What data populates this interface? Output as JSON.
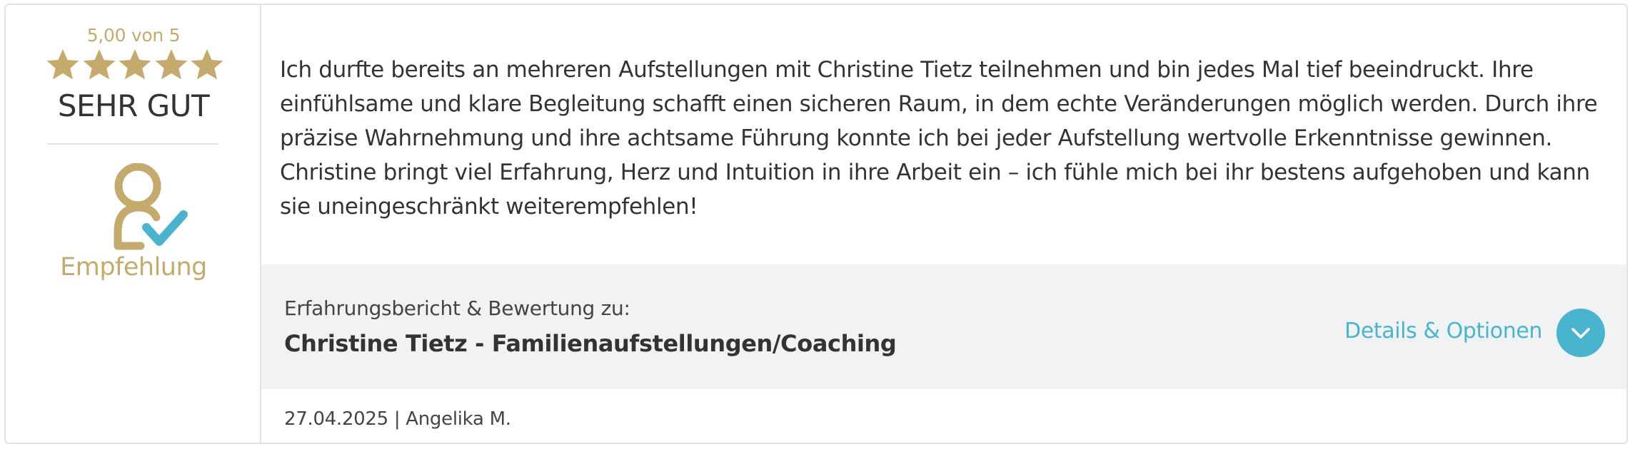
{
  "rating": {
    "score_text": "5,00 von 5",
    "value": 5,
    "max": 5,
    "grade": "SEHR GUT",
    "star_color": "#c4ab6d"
  },
  "recommendation": {
    "icon": "user-check-icon",
    "label": "Empfehlung"
  },
  "review": {
    "text": "Ich durfte bereits an mehreren Aufstellungen mit Christine Tietz teilnehmen und bin jedes Mal tief beeindruckt. Ihre einfühlsame und klare Begleitung schafft einen sicheren Raum, in dem echte Veränderungen möglich werden. Durch ihre präzise Wahrnehmung und ihre achtsame Führung konnte ich bei jeder Aufstellung wertvolle Erkenntnisse gewinnen. Christine bringt viel Erfahrung, Herz und Intuition in ihre Arbeit ein – ich fühle mich bei ihr bestens aufgehoben und kann sie uneingeschränkt weiterempfehlen!"
  },
  "product": {
    "caption": "Erfahrungsbericht & Bewertung zu:",
    "name": "Christine Tietz - Familienaufstellungen/Coaching",
    "details_label": "Details & Optionen",
    "toggle_icon": "chevron-down-icon"
  },
  "meta": {
    "date": "27.04.2025",
    "separator": " | ",
    "author": "Angelika M."
  },
  "colors": {
    "gold": "#c4ab6d",
    "accent": "#4ab4cf",
    "band": "#f1f2f4"
  }
}
